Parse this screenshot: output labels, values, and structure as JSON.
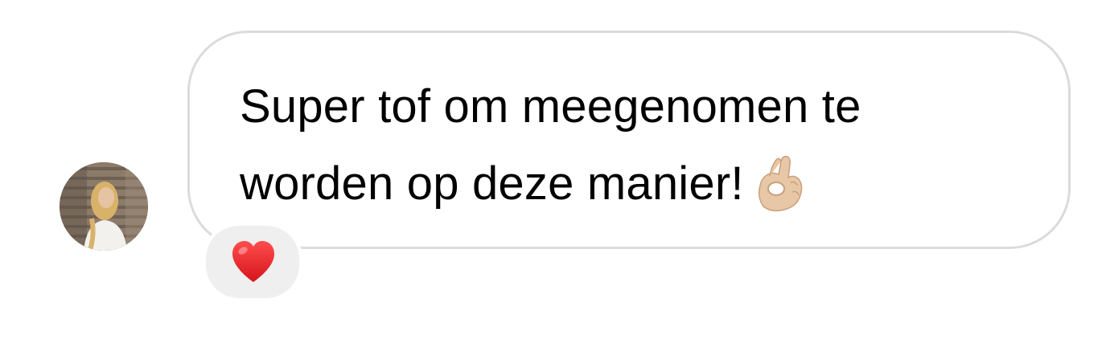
{
  "message": {
    "lines": [
      "Super tof om meegenomen te",
      "worden op deze manier!"
    ],
    "trailing_emoji": "ok-hand-emoji"
  },
  "sender": {
    "avatar": "profile-photo"
  },
  "reaction": {
    "emoji": "red-heart-emoji"
  },
  "colors": {
    "bubble_border": "#dbdbdb",
    "reaction_background": "#efefef",
    "heart": "#e8202a"
  }
}
